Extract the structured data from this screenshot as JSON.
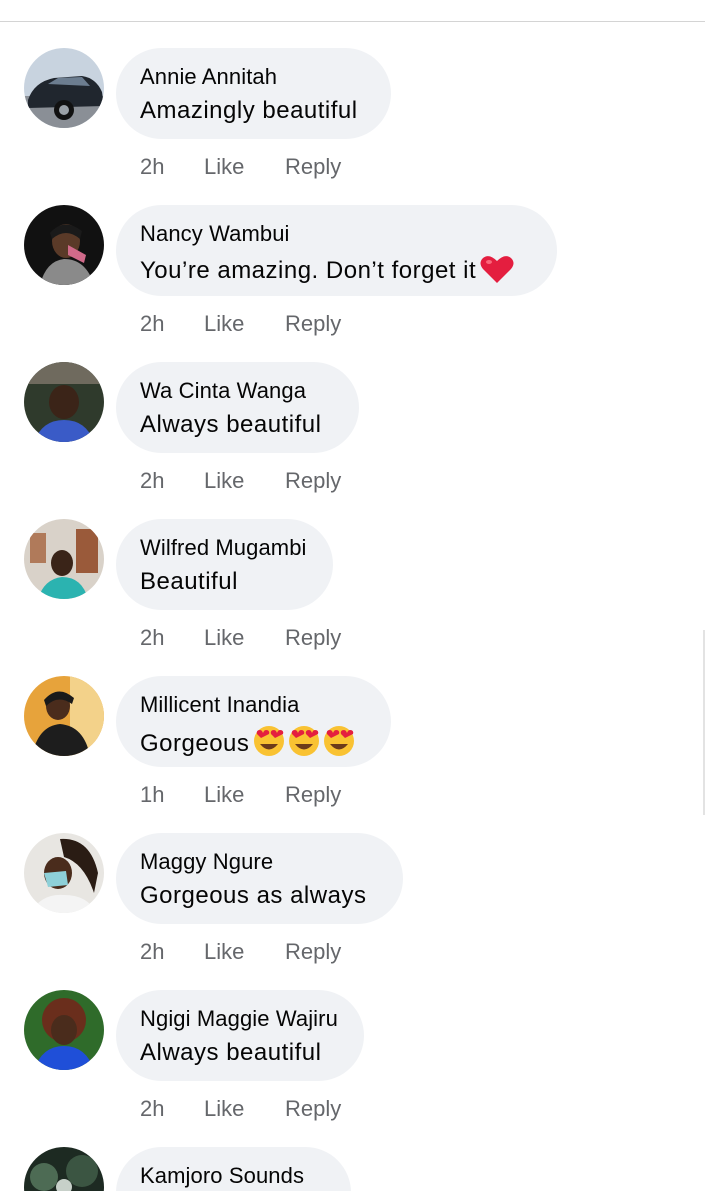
{
  "comments": [
    {
      "author": "Annie Annitah",
      "text": "Amazingly beautiful",
      "emoji": "",
      "time": "2h",
      "like": "Like",
      "reply": "Reply"
    },
    {
      "author": "Nancy Wambui",
      "text": "You’re amazing. Don’t forget it",
      "emoji": "heart",
      "time": "2h",
      "like": "Like",
      "reply": "Reply"
    },
    {
      "author": "Wa Cinta Wanga",
      "text": "Always beautiful",
      "emoji": "",
      "time": "2h",
      "like": "Like",
      "reply": "Reply"
    },
    {
      "author": "Wilfred Mugambi",
      "text": "Beautiful",
      "emoji": "",
      "time": "2h",
      "like": "Like",
      "reply": "Reply"
    },
    {
      "author": "Millicent Inandia",
      "text": "Gorgeous",
      "emoji": "heart-eyes-x3",
      "time": "1h",
      "like": "Like",
      "reply": "Reply"
    },
    {
      "author": "Maggy Ngure",
      "text": "Gorgeous as always",
      "emoji": "",
      "time": "2h",
      "like": "Like",
      "reply": "Reply"
    },
    {
      "author": "Ngigi Maggie Wajiru",
      "text": "Always beautiful",
      "emoji": "",
      "time": "2h",
      "like": "Like",
      "reply": "Reply"
    },
    {
      "author": "Kamjoro Sounds",
      "text": "",
      "emoji": "",
      "time": "",
      "like": "",
      "reply": ""
    }
  ],
  "colors": {
    "bubble": "#f0f2f5",
    "meta_text": "#65676b",
    "name_text": "#050505",
    "heart": "#e41e3f"
  }
}
